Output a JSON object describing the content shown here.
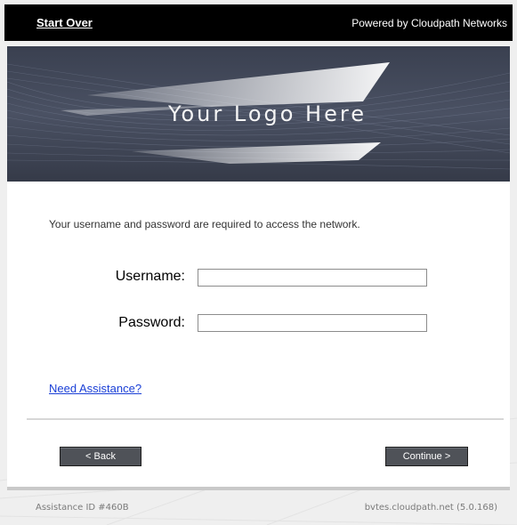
{
  "topbar": {
    "start_over": "Start Over",
    "powered_by": "Powered by Cloudpath Networks"
  },
  "banner": {
    "logo_text": "Your Logo Here"
  },
  "form": {
    "instructions": "Your username and password are required to access the network.",
    "username_label": "Username:",
    "username_value": "",
    "password_label": "Password:",
    "password_value": "",
    "assistance_link": "Need Assistance?"
  },
  "buttons": {
    "back": "< Back",
    "continue": "Continue >"
  },
  "footer": {
    "assistance_id": "Assistance ID #460B",
    "host": "bvtes.cloudpath.net (5.0.168)"
  },
  "colors": {
    "topbar": "#000000",
    "banner": "#3d4352",
    "button": "#4f5258",
    "link": "#1a3fd6"
  }
}
